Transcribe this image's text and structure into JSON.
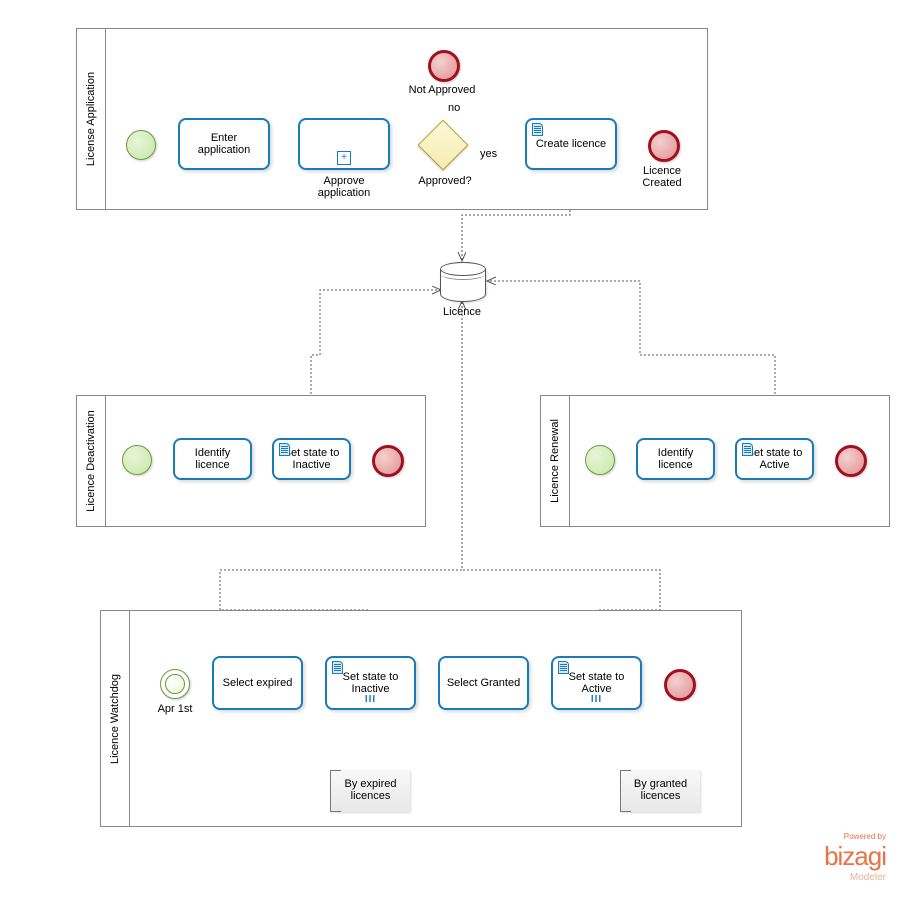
{
  "pools": {
    "application": {
      "title": "License Application"
    },
    "deactivation": {
      "title": "Licence Deactivation"
    },
    "renewal": {
      "title": "Licence Renewal"
    },
    "watchdog": {
      "title": "Licence Watchdog"
    }
  },
  "tasks": {
    "enter_app": "Enter\napplication",
    "approve_app": "",
    "approve_app_label": "Approve application",
    "create_licence": "Create licence",
    "identify_deact": "Identify licence",
    "set_inactive_deact": "Set state to\nInactive",
    "identify_renew": "Identify licence",
    "set_active_renew": "Set state to\nActive",
    "select_expired": "Select expired",
    "set_inactive_wd": "Set state to\nInactive",
    "select_granted": "Select Granted",
    "set_active_wd": "Set state to\nActive"
  },
  "labels": {
    "not_approved": "Not Approved",
    "no": "no",
    "yes": "yes",
    "approved_q": "Approved?",
    "licence_created": "Licence\nCreated",
    "apr1": "Apr 1st",
    "datastore": "Licence",
    "by_expired": "By expired\nlicences",
    "by_granted": "By granted\nlicences"
  },
  "logo": {
    "powered": "Powered by",
    "brand": "bizagi",
    "sub": "Modeler"
  },
  "chart_data": {
    "type": "bpmn-diagram",
    "pools": [
      {
        "name": "License Application",
        "elements": [
          "start",
          "Enter application (task)",
          "Approve application (subprocess)",
          "Approved? (exclusive gateway)",
          "Not Approved (end)",
          "Create licence (business-rule task)",
          "Licence Created (end)"
        ]
      },
      {
        "name": "Licence Deactivation",
        "elements": [
          "start",
          "Identify licence (task)",
          "Set state to Inactive (business-rule task)",
          "end"
        ]
      },
      {
        "name": "Licence Renewal",
        "elements": [
          "start",
          "Identify licence (task)",
          "Set state to Active (business-rule task)",
          "end"
        ]
      },
      {
        "name": "Licence Watchdog",
        "elements": [
          "timer start Apr 1st",
          "Select expired (task)",
          "Set state to Inactive (multi-instance business-rule task)",
          "Select Granted (task)",
          "Set state to Active (multi-instance business-rule task)",
          "end"
        ]
      }
    ],
    "datastore": "Licence",
    "sequence_flows": [
      [
        "start",
        "Enter application"
      ],
      [
        "Enter application",
        "Approve application"
      ],
      [
        "Approve application",
        "Approved?"
      ],
      [
        "Approved?",
        "Not Approved end",
        "no"
      ],
      [
        "Approved?",
        "Create licence",
        "yes"
      ],
      [
        "Create licence",
        "Licence Created end"
      ],
      [
        "start",
        "Identify licence (deact)"
      ],
      [
        "Identify licence (deact)",
        "Set state to Inactive (deact)"
      ],
      [
        "Set state to Inactive (deact)",
        "end"
      ],
      [
        "start",
        "Identify licence (renew)"
      ],
      [
        "Identify licence (renew)",
        "Set state to Active (renew)"
      ],
      [
        "Set state to Active (renew)",
        "end"
      ],
      [
        "timer",
        "Select expired"
      ],
      [
        "Select expired",
        "Set state to Inactive (wd)"
      ],
      [
        "Set state to Inactive (wd)",
        "Select Granted"
      ],
      [
        "Select Granted",
        "Set state to Active (wd)"
      ],
      [
        "Set state to Active (wd)",
        "end"
      ]
    ],
    "data_associations": [
      [
        "Create licence",
        "Licence datastore"
      ],
      [
        "Set state to Inactive (deact)",
        "Licence datastore"
      ],
      [
        "Set state to Active (renew)",
        "Licence datastore"
      ],
      [
        "Set state to Inactive (wd)",
        "Licence datastore"
      ],
      [
        "Set state to Active (wd)",
        "Licence datastore"
      ]
    ],
    "annotations": [
      {
        "text": "By expired licences",
        "attached_to": "Set state to Inactive (wd)"
      },
      {
        "text": "By granted licences",
        "attached_to": "Set state to Active (wd)"
      }
    ]
  }
}
